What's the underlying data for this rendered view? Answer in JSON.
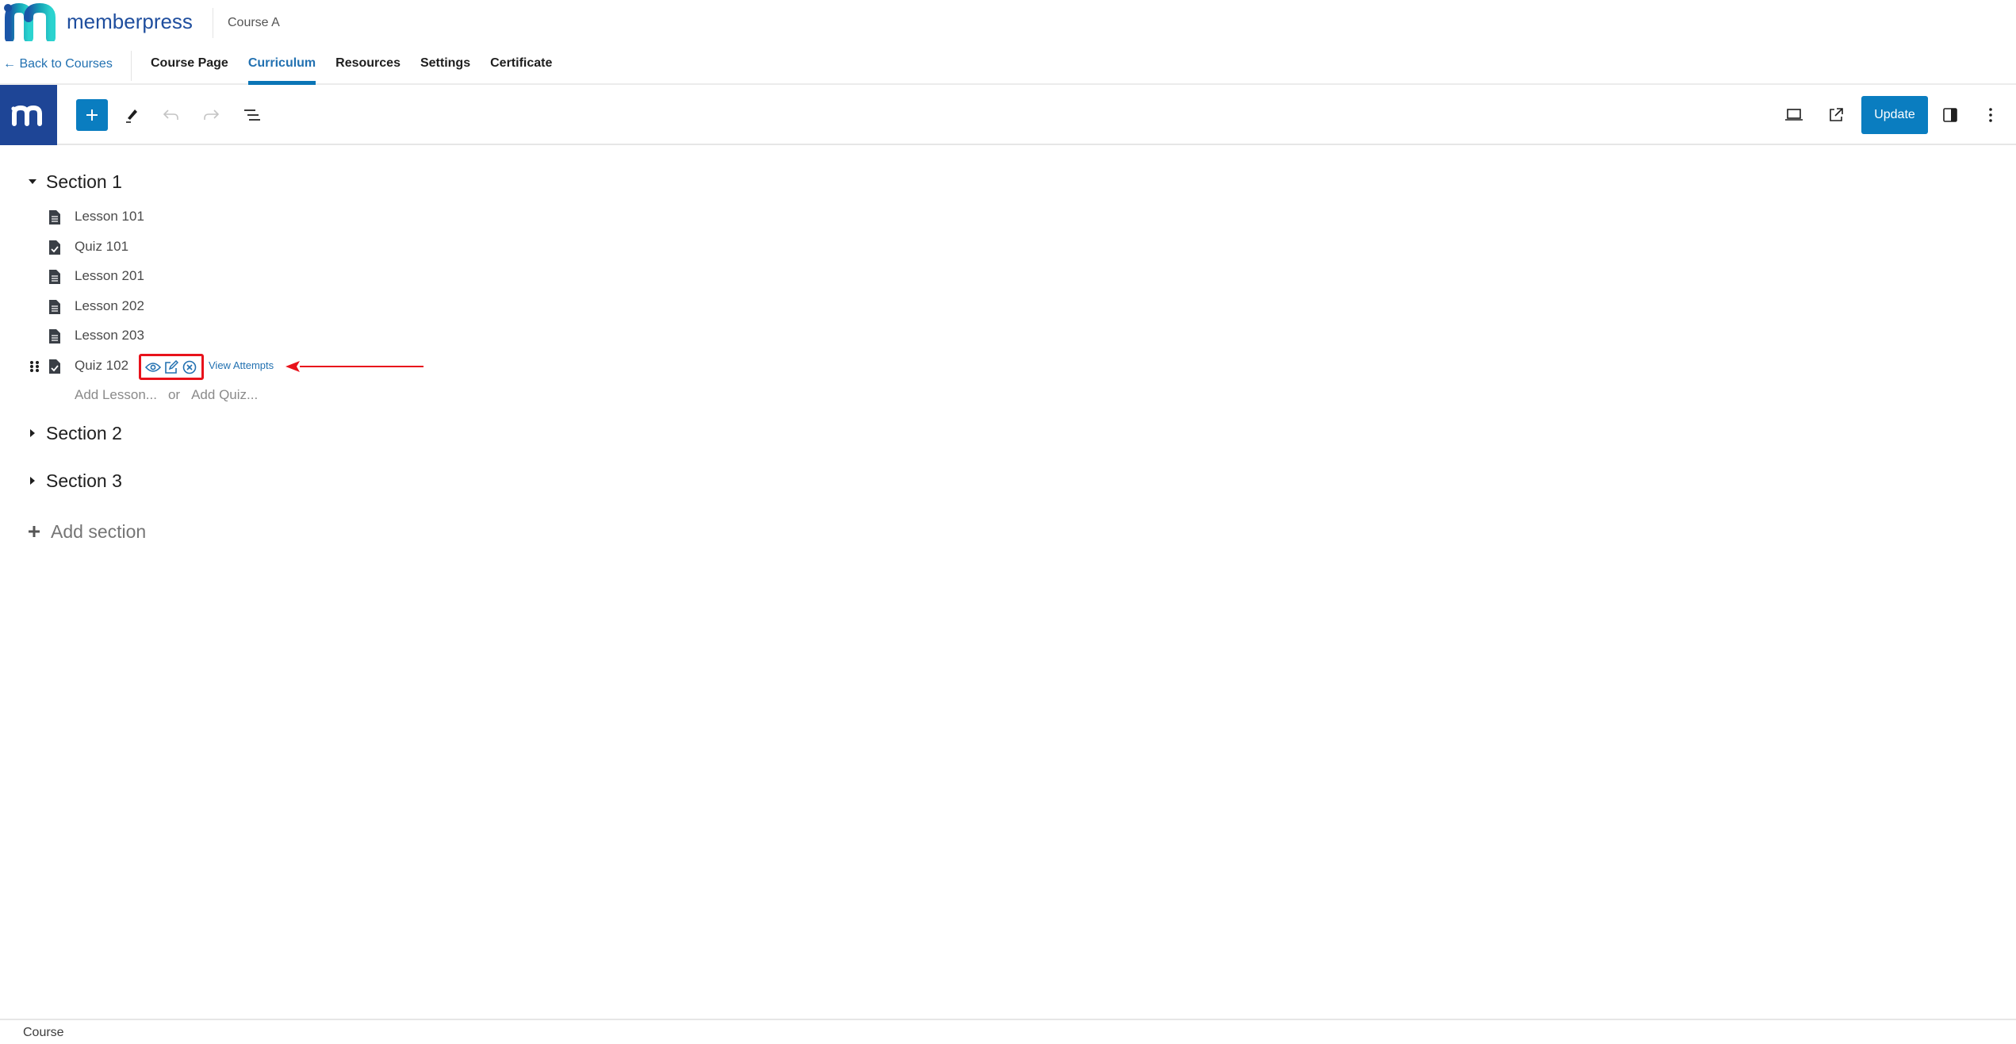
{
  "brand": {
    "name": "memberpress",
    "logo_icon": "memberpress-logo-icon",
    "colors": {
      "primary": "#1f4e9e",
      "teal": "#23c3c9",
      "site_icon_bg": "#1e4596"
    }
  },
  "header": {
    "course_title": "Course A",
    "back_link": "← Back to Courses",
    "tabs": [
      {
        "label": "Course Page",
        "active": false
      },
      {
        "label": "Curriculum",
        "active": true
      },
      {
        "label": "Resources",
        "active": false
      },
      {
        "label": "Settings",
        "active": false
      },
      {
        "label": "Certificate",
        "active": false
      }
    ],
    "accent_color": "#0a75b6"
  },
  "toolbar": {
    "left_icons": [
      "site-m-icon",
      "plus-icon",
      "pen-icon",
      "undo-icon",
      "redo-icon",
      "list-view-icon"
    ],
    "right_icons": [
      "laptop-preview-icon",
      "external-link-icon",
      "sidebar-toggle-icon",
      "more-vertical-icon"
    ],
    "update_label": "Update",
    "update_color": "#0a7dc0"
  },
  "curriculum": {
    "sections": [
      {
        "title": "Section 1",
        "expanded": true,
        "items": [
          {
            "title": "Lesson 101",
            "type": "lesson",
            "icon": "document-icon"
          },
          {
            "title": "Quiz 101",
            "type": "quiz",
            "icon": "quiz-document-icon"
          },
          {
            "title": "Lesson 201",
            "type": "lesson",
            "icon": "document-icon"
          },
          {
            "title": "Lesson 202",
            "type": "lesson",
            "icon": "document-icon"
          },
          {
            "title": "Lesson 203",
            "type": "lesson",
            "icon": "document-icon"
          },
          {
            "title": "Quiz 102",
            "type": "quiz",
            "icon": "quiz-document-icon",
            "hovered": true,
            "actions": [
              "eye-icon",
              "edit-icon",
              "remove-circle-icon"
            ],
            "view_attempts": "View Attempts"
          }
        ],
        "add_lesson": "Add Lesson...",
        "or": "or",
        "add_quiz": "Add Quiz..."
      },
      {
        "title": "Section 2",
        "expanded": false
      },
      {
        "title": "Section 3",
        "expanded": false
      }
    ],
    "add_section": "Add section"
  },
  "annotation": {
    "highlight_color": "#e8121b",
    "arrow": "red-arrow-pointing-left"
  },
  "footer": {
    "breadcrumb": "Course"
  }
}
